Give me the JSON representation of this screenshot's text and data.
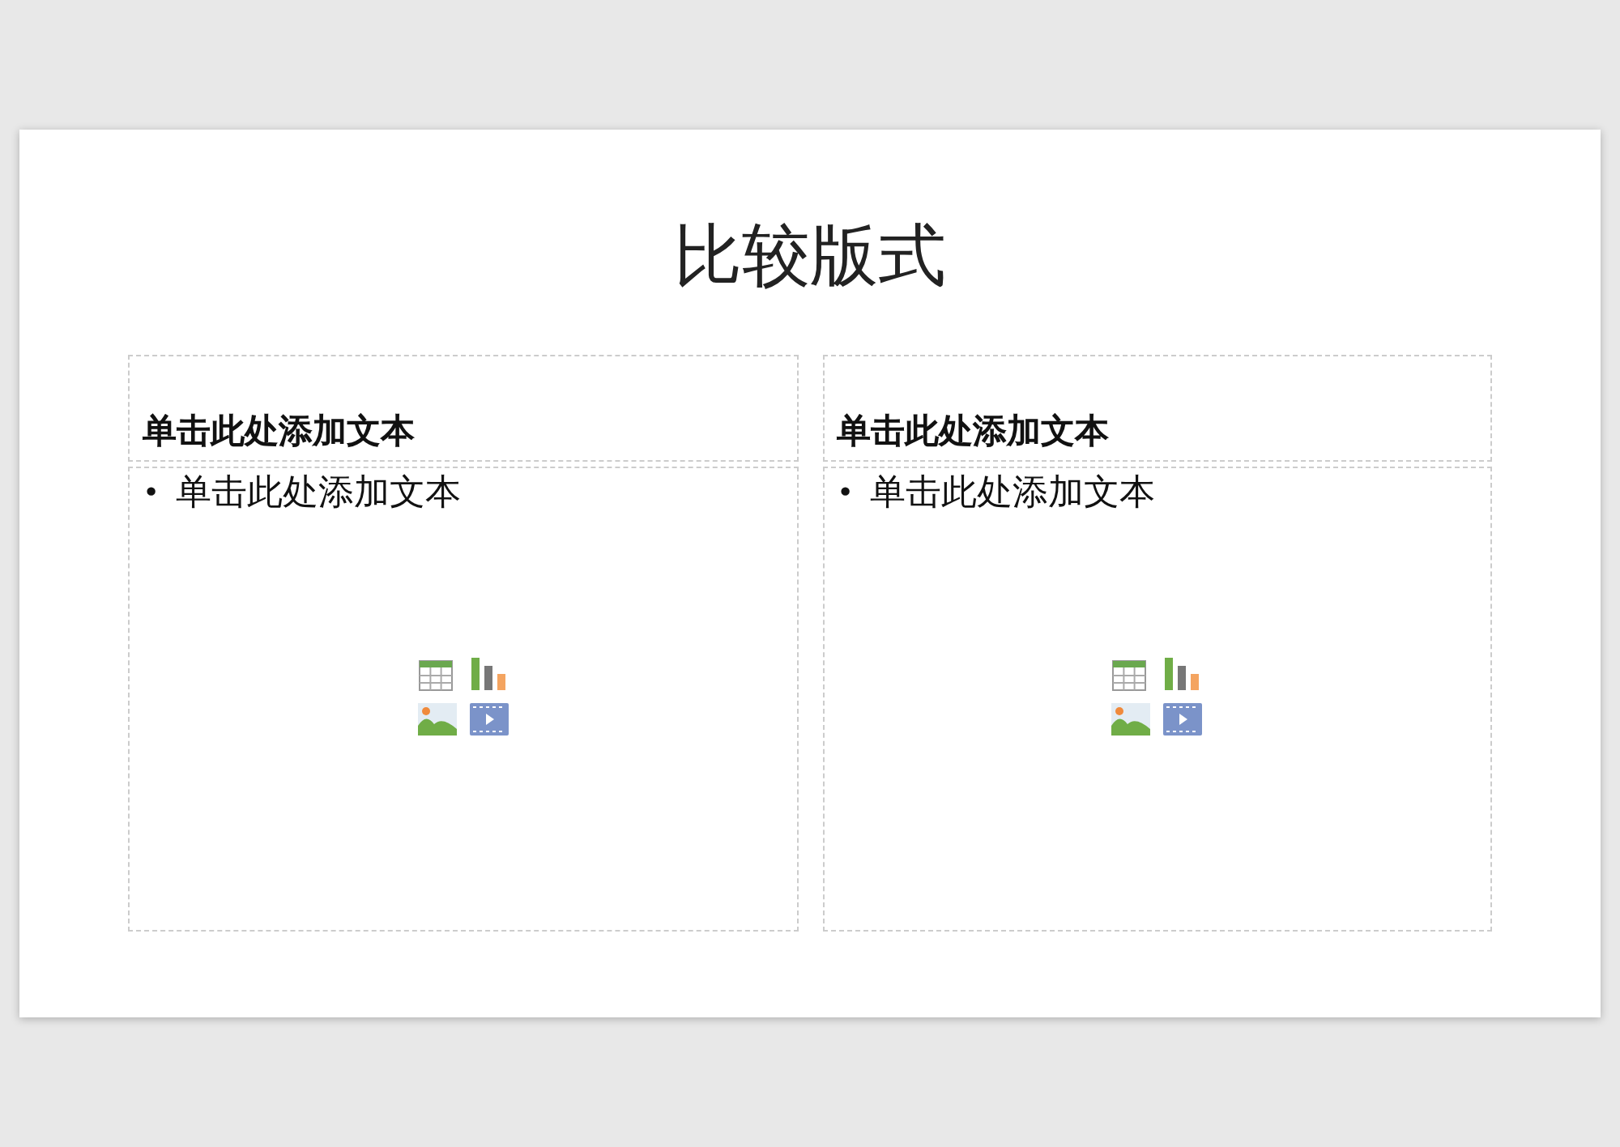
{
  "slide": {
    "title": "比较版式",
    "columns": [
      {
        "heading": "单击此处添加文本",
        "bullet": "•",
        "body": "单击此处添加文本"
      },
      {
        "heading": "单击此处添加文本",
        "bullet": "•",
        "body": "单击此处添加文本"
      }
    ]
  }
}
